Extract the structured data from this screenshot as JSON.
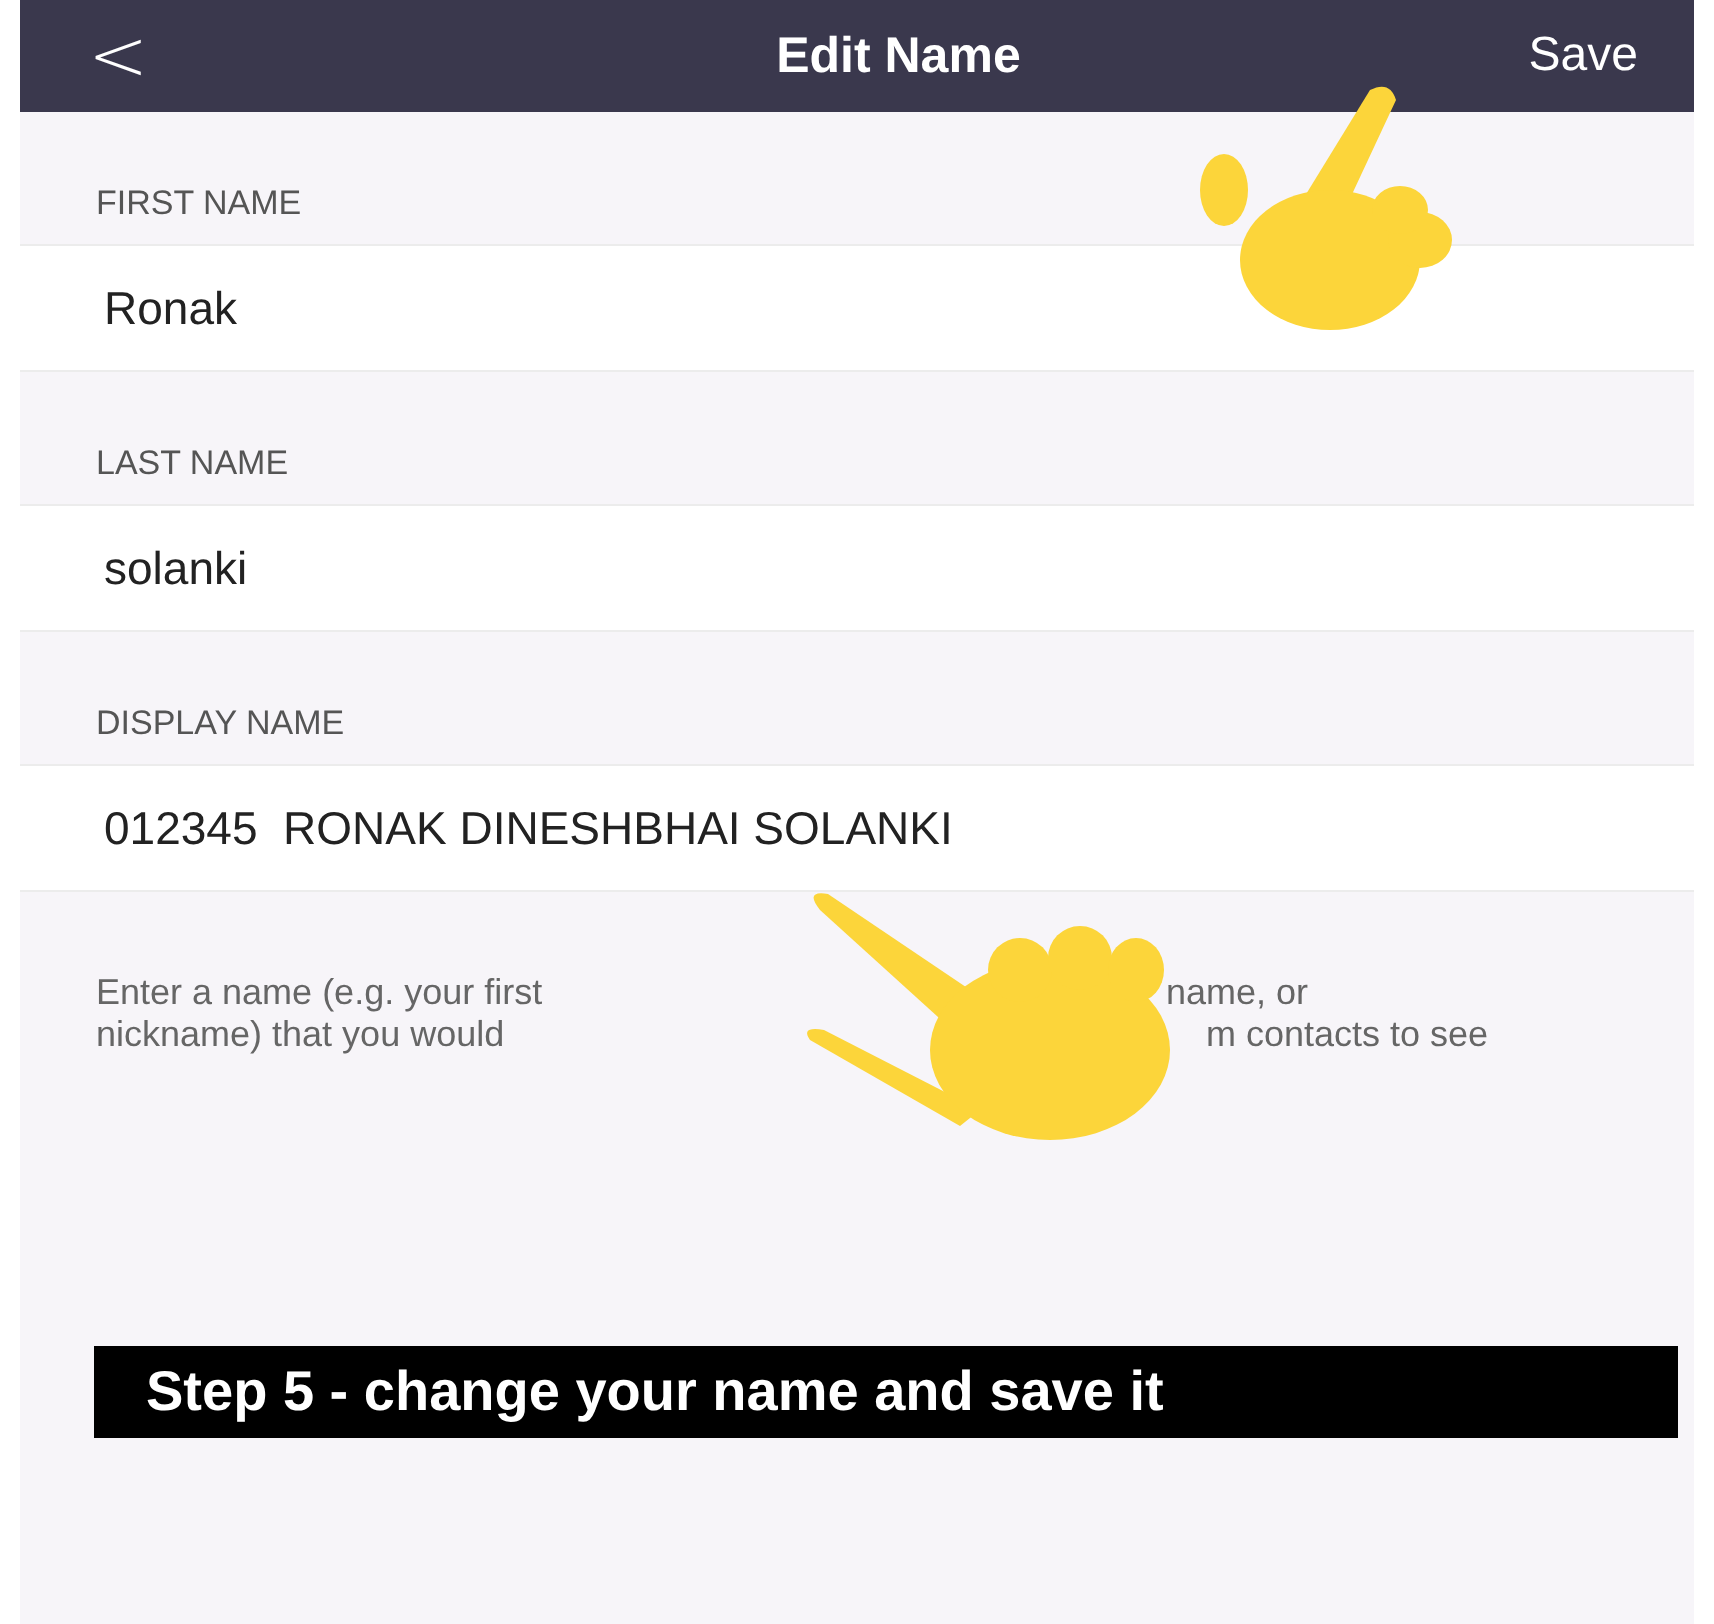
{
  "header": {
    "back": "<",
    "title": "Edit Name",
    "save": "Save"
  },
  "fields": [
    {
      "label": "FIRST NAME",
      "value": "Ronak"
    },
    {
      "label": "LAST NAME",
      "value": "solanki"
    },
    {
      "label": "DISPLAY NAME",
      "value": "012345  RONAK DINESHBHAI SOLANKI"
    }
  ],
  "hint_lines": [
    {
      "left": "Enter a name (e.g. your first",
      "right": "name, or"
    },
    {
      "left": "nickname) that you would",
      "right": "m contacts to see"
    }
  ],
  "caption": "Step 5 - change your name and save it"
}
